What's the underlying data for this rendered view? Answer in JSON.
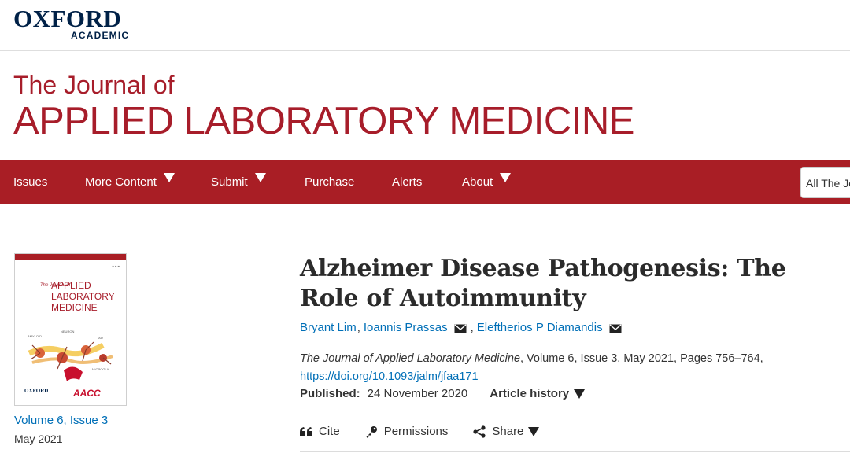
{
  "publisher": {
    "name": "OXFORD",
    "sub": "ACADEMIC"
  },
  "journal": {
    "line1": "The Journal of",
    "line2": "APPLIED LABORATORY MEDICINE"
  },
  "nav": {
    "items": [
      {
        "label": "Issues",
        "dropdown": false
      },
      {
        "label": "More Content",
        "dropdown": true
      },
      {
        "label": "Submit",
        "dropdown": true
      },
      {
        "label": "Purchase",
        "dropdown": false
      },
      {
        "label": "Alerts",
        "dropdown": false
      },
      {
        "label": "About",
        "dropdown": true
      }
    ],
    "search_scope": "All The Jo"
  },
  "cover": {
    "small": "The Journal of",
    "title_line1": "APPLIED",
    "title_line2": "LABORATORY",
    "title_line3": "MEDICINE",
    "publisher": "OXFORD",
    "society": "AACC"
  },
  "issue": {
    "link": "Volume 6, Issue 3",
    "date": "May 2021"
  },
  "article": {
    "title": "Alzheimer Disease Pathogenesis: The Role of Autoimmunity",
    "authors": [
      {
        "name": "Bryant Lim",
        "email": false
      },
      {
        "name": "Ioannis Prassas",
        "email": true
      },
      {
        "name": "Eleftherios P Diamandis",
        "email": true
      }
    ],
    "citation_journal": "The Journal of Applied Laboratory Medicine",
    "citation_rest": ", Volume 6, Issue 3, May 2021, Pages 756–764,",
    "doi": "https://doi.org/10.1093/jalm/jfaa171",
    "published_label": "Published:",
    "published_date": "24 November 2020",
    "history_label": "Article history"
  },
  "tools": {
    "cite": "Cite",
    "permissions": "Permissions",
    "share": "Share"
  },
  "colors": {
    "brand_red": "#a91e25",
    "oxford_blue": "#002147",
    "link_blue": "#006fb7"
  }
}
